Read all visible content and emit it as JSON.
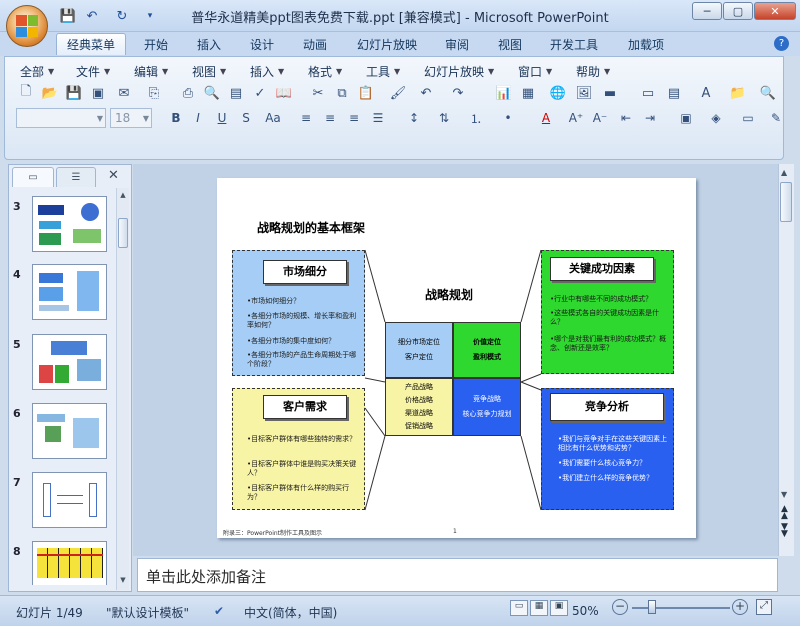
{
  "window": {
    "title": "普华永道精美ppt图表免费下载.ppt [兼容模式] - Microsoft PowerPoint",
    "min": "─",
    "max": "▢",
    "close": "✕"
  },
  "qat": {
    "save": "💾",
    "undo": "↶",
    "redo": "↻",
    "more": "▾"
  },
  "tabs": [
    "经典菜单",
    "开始",
    "插入",
    "设计",
    "动画",
    "幻灯片放映",
    "审阅",
    "视图",
    "开发工具",
    "加载项"
  ],
  "help": "?",
  "menus": [
    "全部",
    "文件",
    "编辑",
    "视图",
    "插入",
    "格式",
    "工具",
    "幻灯片放映",
    "窗口",
    "帮助"
  ],
  "font_size_value": "18",
  "format_buttons": {
    "bold": "B",
    "italic": "I",
    "underline": "U",
    "shadow": "S",
    "case": "Aa"
  },
  "pane_tabs": {
    "slides": "▭",
    "outline": "☰",
    "close": "✕"
  },
  "thumbnails": [
    {
      "n": "3"
    },
    {
      "n": "4"
    },
    {
      "n": "5"
    },
    {
      "n": "6"
    },
    {
      "n": "7"
    },
    {
      "n": "8"
    }
  ],
  "slide": {
    "title": "战略规划的基本框架",
    "center_title": "战略规划",
    "panels": {
      "market": {
        "head": "市场细分",
        "bullets": [
          "•市场如何细分？",
          "•各细分市场的规模、增长率和盈利率如何？",
          "•各细分市场的集中度如何？",
          "•各细分市场的产品生命周期处于哪个阶段？"
        ]
      },
      "customer": {
        "head": "客户需求",
        "bullets": [
          "•目标客户群体有哪些独特的需求？",
          "•目标客户群体中谁是购买决策关键人？",
          "•目标客户群体有什么样的购买行为？"
        ]
      },
      "ksf": {
        "head": "关键成功因素",
        "bullets": [
          "•行业中有哪些不同的成功模式？",
          "•这些模式各自的关键成功因素是什么？",
          "•哪个是对我们最有利的成功模式？概念、创新还是效率？"
        ]
      },
      "competition": {
        "head": "竞争分析",
        "bullets": [
          "•我们与竞争对手在这些关键因素上相比有什么优势和劣势？",
          "•我们需要什么核心竞争力？",
          "•我们建立什么样的竞争优势？"
        ]
      }
    },
    "grid": {
      "tl": [
        "细分市场定位",
        "客户定位"
      ],
      "tr": [
        "价值定位",
        "盈利模式"
      ],
      "bl": [
        "产品战略",
        "价格战略",
        "渠道战略",
        "促销战略"
      ],
      "br": [
        "竞争战略",
        "核心竞争力规划"
      ]
    },
    "footer": "附录三：PowerPoint制作工具及图示",
    "page": "1"
  },
  "notes_placeholder": "单击此处添加备注",
  "status": {
    "slide": "幻灯片 1/49",
    "theme": "\"默认设计模板\"",
    "lang": "中文(简体，中国)",
    "zoom": "50%"
  },
  "colors": {
    "market": "#a6cdf5",
    "customer": "#f8f4a6",
    "ksf": "#2ed82e",
    "competition": "#2a60f0",
    "cell_blue": "#a6cdf5",
    "cell_green": "#2ed82e",
    "cell_yellow": "#f8f4a6",
    "cell_dark": "#2a60f0"
  }
}
